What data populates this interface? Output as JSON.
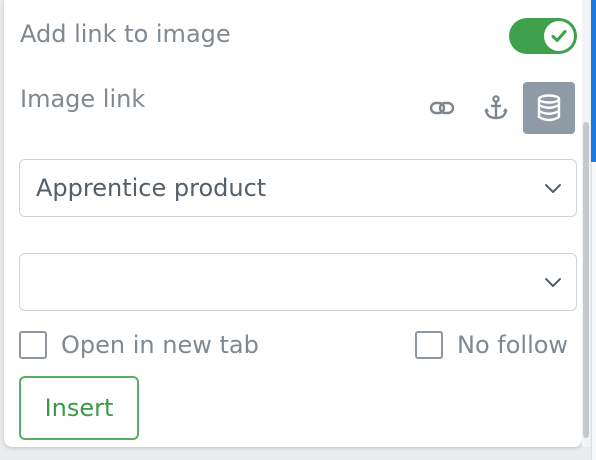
{
  "settings": {
    "add_link_label": "Add link to image",
    "add_link_enabled": true,
    "image_link_label": "Image link",
    "link_type_icons": [
      "link-icon",
      "anchor-icon",
      "database-icon"
    ],
    "active_link_type": "database-icon"
  },
  "product_select": {
    "value": "Apprentice product"
  },
  "secondary_select": {
    "value": ""
  },
  "options": {
    "open_new_tab_label": "Open in new tab",
    "open_new_tab_checked": false,
    "no_follow_label": "No follow",
    "no_follow_checked": false
  },
  "actions": {
    "insert_label": "Insert"
  },
  "colors": {
    "toggle_on": "#3fa14c",
    "insert_accent": "#3b9a48",
    "active_icon_bg": "#8e9aa5",
    "scrollbar_accent": "#1a7ae6"
  }
}
